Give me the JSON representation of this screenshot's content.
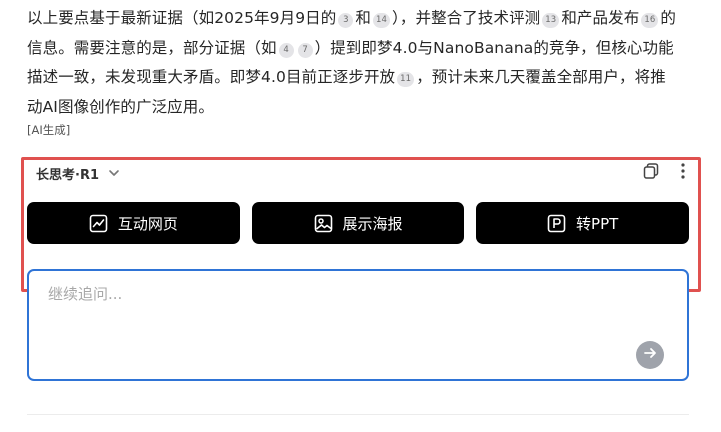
{
  "answer": {
    "l1a": "以上要点基于最新证据（如2025年9月9日的",
    "c3": "3",
    "l1b": "和",
    "c14": "14",
    "l1c": "），并整合了技术评测",
    "c13": "13",
    "l1d": "和产品发布",
    "c16": "16",
    "l1e": "的",
    "l2a": "信息。需要注意的是，部分证据（如",
    "c4": "4",
    "c7": "7",
    "l2b": "）提到即梦4.0与NanoBanana的竞争，但核心功能",
    "l3a": "描述一致，未发现重大矛盾。即梦4.0目前正逐步开放",
    "c11": "11",
    "l3b": "，预计未来几天覆盖全部用户，将推",
    "l4": "动AI图像创作的广泛应用。"
  },
  "ai_note": "[AI生成]",
  "model": {
    "name": "长思考·R1",
    "icon": "chevron-down-icon"
  },
  "toolbar_icons": [
    "copy-icon",
    "more-vertical-icon"
  ],
  "actions": [
    {
      "label": "互动网页",
      "icon": "chart-line-icon"
    },
    {
      "label": "展示海报",
      "icon": "image-icon"
    },
    {
      "label": "转PPT",
      "icon": "ppt-icon"
    }
  ],
  "composer": {
    "placeholder": "继续追问...",
    "value": "",
    "send_icon": "arrow-right-icon"
  },
  "colors": {
    "highlight": "#e0514f",
    "composer_border": "#2f74d6",
    "button_bg": "#000000",
    "send_bg": "#9fa3ab",
    "citation_bg": "#e4e4e7"
  }
}
